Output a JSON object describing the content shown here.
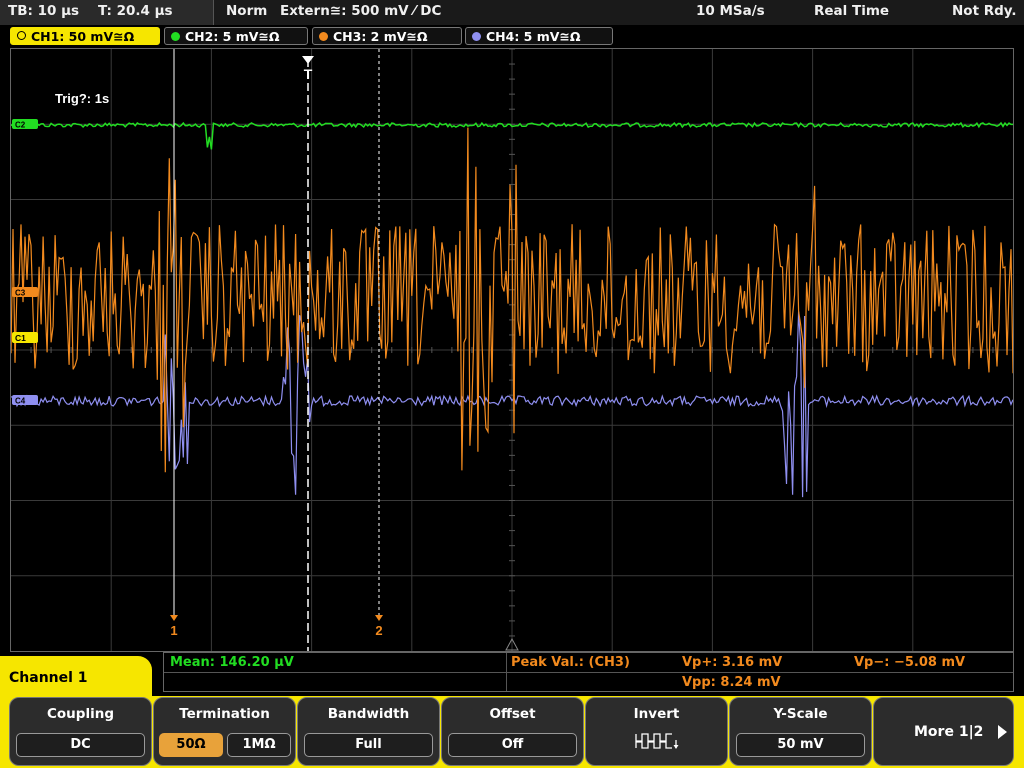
{
  "status": {
    "timebase": "TB: 10 µs",
    "trigger_pos": "T: 20.4 µs",
    "mode": "Norm",
    "trigger_source": "Extern≅: 500 mV ⁄ DC",
    "sample_rate": "10 MSa/s",
    "acq_mode": "Real Time",
    "state": "Not Rdy."
  },
  "channels": [
    {
      "label": "CH1: 50 mV≅Ω",
      "color": "#f6e600",
      "active": true
    },
    {
      "label": "CH2: 5 mV≅Ω",
      "color": "#22dd22",
      "active": false
    },
    {
      "label": "CH3: 2 mV≅Ω",
      "color": "#f28a1e",
      "active": false
    },
    {
      "label": "CH4: 5 mV≅Ω",
      "color": "#8f8ff0",
      "active": false
    }
  ],
  "screen": {
    "trig_text": "Trig?: 1s",
    "trigger_marker": "T",
    "cursor1_label": "1",
    "cursor2_label": "2",
    "markers": {
      "ch1": "C1",
      "ch2": "C2",
      "ch3": "C3",
      "ch4": "C4"
    }
  },
  "measurements": {
    "mean": "Mean: 146.20 µV",
    "peak": "Peak Val.:  (CH3)",
    "vp_plus": "Vp+: 3.16 mV",
    "vpp": "Vpp: 8.24 mV",
    "vp_minus": "Vp−: −5.08 mV"
  },
  "menu": {
    "title": "Channel 1",
    "coupling": {
      "label": "Coupling",
      "value": "DC"
    },
    "termination": {
      "label": "Termination",
      "opt1": "50Ω",
      "opt2": "1MΩ",
      "selected": "50Ω"
    },
    "bandwidth": {
      "label": "Bandwidth",
      "value": "Full"
    },
    "offset": {
      "label": "Offset",
      "value": "Off"
    },
    "invert": {
      "label": "Invert",
      "icon": "inverted-square-wave-icon"
    },
    "yscale": {
      "label": "Y-Scale",
      "value": "50 mV"
    },
    "more": {
      "label": "More 1|2"
    }
  },
  "colors": {
    "ch1": "#f6e600",
    "ch2": "#22dd22",
    "ch3": "#f28a1e",
    "ch4": "#8f8ff0",
    "menu": "#f6e600",
    "selected": "#e8a23a"
  }
}
